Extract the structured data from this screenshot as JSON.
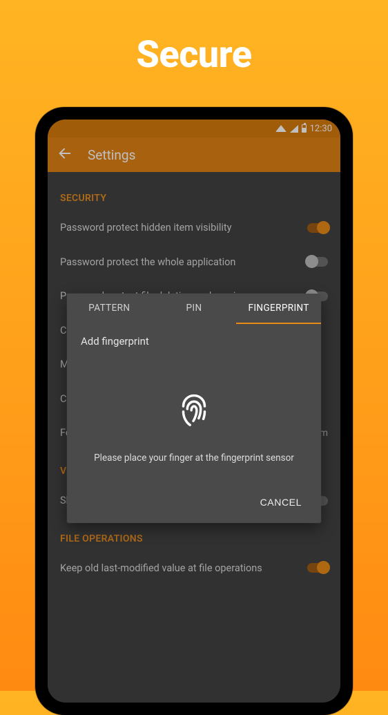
{
  "hero": {
    "title": "Secure"
  },
  "statusbar": {
    "time": "12:30"
  },
  "appbar": {
    "title": "Settings"
  },
  "sections": {
    "security": {
      "header": "SECURITY",
      "items": [
        {
          "label": "Password protect hidden item visibility",
          "toggle": true
        },
        {
          "label": "Password protect the whole application",
          "toggle": false
        },
        {
          "label": "Password protect file deletion and moving",
          "toggle": false
        }
      ],
      "truncated": [
        {
          "prefix": "Cu"
        },
        {
          "prefix": "Ma"
        },
        {
          "prefix": "Ch"
        },
        {
          "prefix": "Fo",
          "suffix": "um"
        }
      ]
    },
    "visible": {
      "header_prefix": "VI",
      "item_prefix": "Sh"
    },
    "file_ops": {
      "header": "FILE OPERATIONS",
      "items": [
        {
          "label": "Keep old last-modified value at file operations",
          "toggle": true
        }
      ]
    }
  },
  "dialog": {
    "tabs": {
      "pattern": "PATTERN",
      "pin": "PIN",
      "fingerprint": "FINGERPRINT"
    },
    "active_tab": "fingerprint",
    "subtitle": "Add fingerprint",
    "hint": "Please place your finger at the fingerprint sensor",
    "cancel": "CANCEL"
  }
}
